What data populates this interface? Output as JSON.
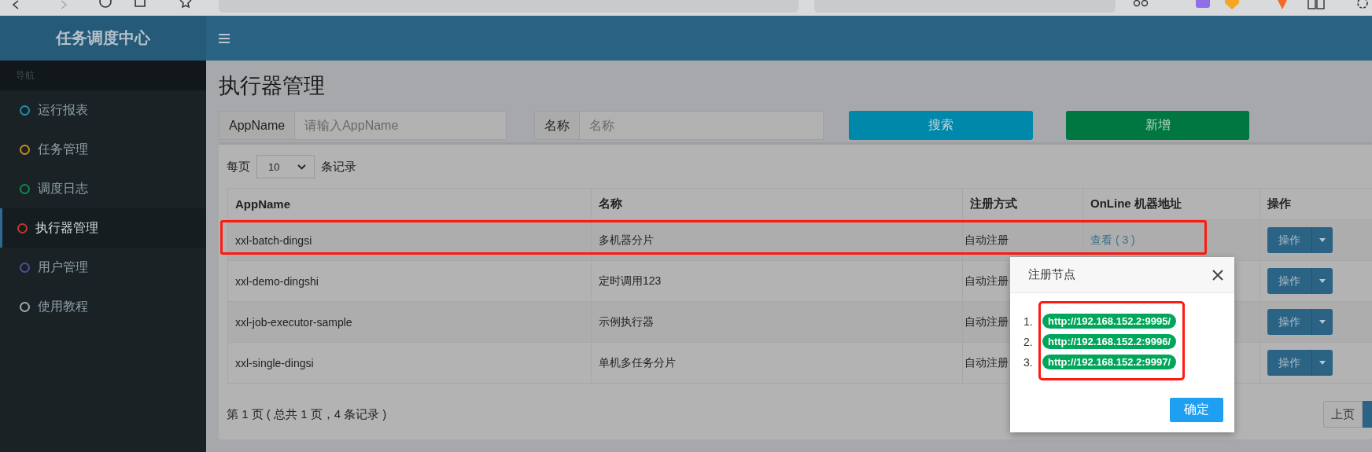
{
  "sidebar": {
    "logo": "任务调度中心",
    "heading": "导航",
    "items": [
      {
        "label": "运行报表",
        "color": "#1f90ad",
        "selected": false
      },
      {
        "label": "任务管理",
        "color": "#c98a1f",
        "selected": false
      },
      {
        "label": "调度日志",
        "color": "#0d8a4d",
        "selected": false
      },
      {
        "label": "执行器管理",
        "color": "#c0392b",
        "selected": true
      },
      {
        "label": "用户管理",
        "color": "#5b4a9c",
        "selected": false
      },
      {
        "label": "使用教程",
        "color": "#aaaaaa",
        "selected": false
      }
    ]
  },
  "page": {
    "title": "执行器管理"
  },
  "filters": [
    {
      "label": "AppName",
      "placeholder": "请输入AppName"
    },
    {
      "label": "名称",
      "placeholder": "名称"
    }
  ],
  "buttons": [
    {
      "label": "搜索",
      "kind": "search"
    },
    {
      "label": "新增",
      "kind": "add"
    }
  ],
  "page_size": {
    "prefix": "每页",
    "value": "10",
    "suffix": "条记录"
  },
  "table": {
    "columns": [
      "AppName",
      "名称",
      "注册方式",
      "OnLine 机器地址",
      "操作"
    ],
    "rows": [
      {
        "appname": "xxl-batch-dingsi",
        "name": "多机器分片",
        "registration": "自动注册",
        "online": "查看 ( 3 )",
        "action": "操作",
        "highlighted": true
      },
      {
        "appname": "xxl-demo-dingshi",
        "name": "定时调用123",
        "registration": "自动注册",
        "action": "操作",
        "highlighted": false
      },
      {
        "appname": "xxl-job-executor-sample",
        "name": "示例执行器",
        "registration": "自动注册",
        "action": "操作",
        "highlighted": false
      },
      {
        "appname": "xxl-single-dingsi",
        "name": "单机多任务分片",
        "registration": "自动注册",
        "action": "操作",
        "highlighted": false
      }
    ]
  },
  "pagination": {
    "info": "第 1 页 ( 总共 1 页，4 条记录 )",
    "prev": "上页"
  },
  "dialog": {
    "title": "注册节点",
    "highlighted": true,
    "addresses": [
      {
        "index": "1.",
        "url": "http://192.168.152.2:9995/"
      },
      {
        "index": "2.",
        "url": "http://192.168.152.2:9996/"
      },
      {
        "index": "3.",
        "url": "http://192.168.152.2:9997/"
      }
    ],
    "confirm": "确定"
  }
}
